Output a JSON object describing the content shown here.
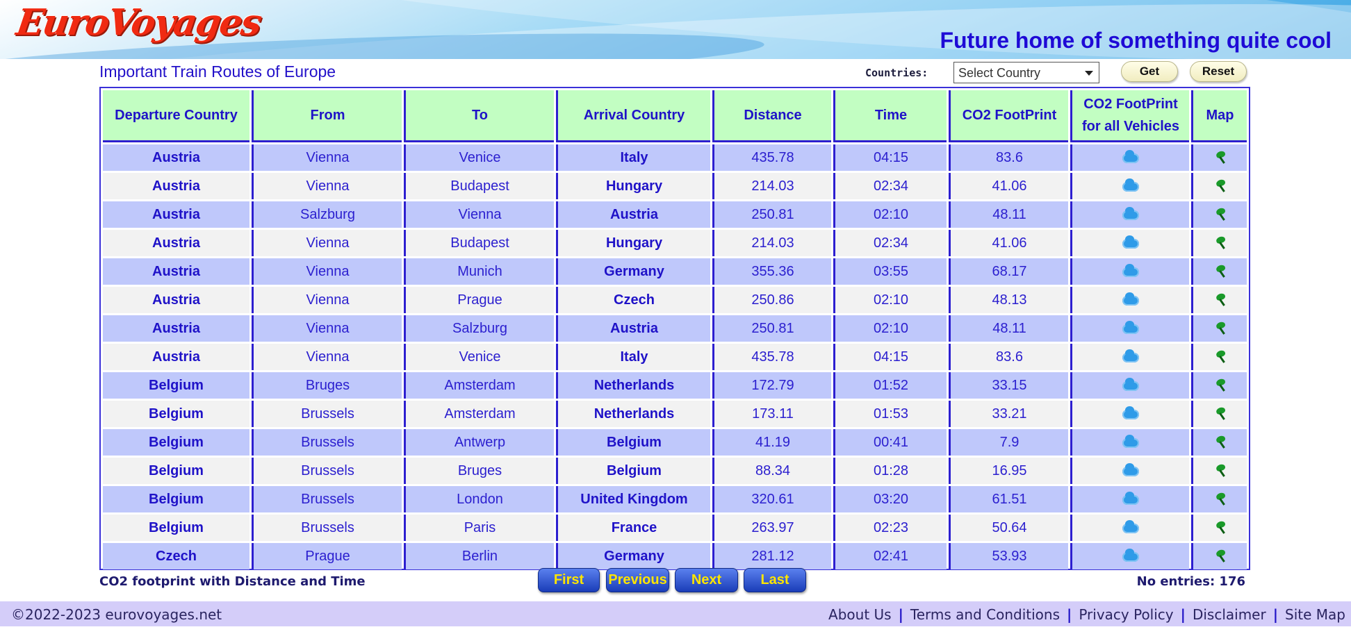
{
  "header": {
    "logo_text": "EuroVoyages",
    "tagline": "Future home of something quite cool"
  },
  "page": {
    "title": "Important Train Routes of Europe",
    "countries_label": "Countries:",
    "country_select_value": "Select Country",
    "get_label": "Get",
    "reset_label": "Reset"
  },
  "table": {
    "columns": [
      "Departure Country",
      "From",
      "To",
      "Arrival Country",
      "Distance",
      "Time",
      "CO2 FootPrint",
      "CO2 FootPrint for all Vehicles",
      "Map"
    ],
    "rows": [
      {
        "dep": "Austria",
        "from": "Vienna",
        "to": "Venice",
        "arr": "Italy",
        "dist": "435.78",
        "time": "04:15",
        "co2": "83.6"
      },
      {
        "dep": "Austria",
        "from": "Vienna",
        "to": "Budapest",
        "arr": "Hungary",
        "dist": "214.03",
        "time": "02:34",
        "co2": "41.06"
      },
      {
        "dep": "Austria",
        "from": "Salzburg",
        "to": "Vienna",
        "arr": "Austria",
        "dist": "250.81",
        "time": "02:10",
        "co2": "48.11"
      },
      {
        "dep": "Austria",
        "from": "Vienna",
        "to": "Budapest",
        "arr": "Hungary",
        "dist": "214.03",
        "time": "02:34",
        "co2": "41.06"
      },
      {
        "dep": "Austria",
        "from": "Vienna",
        "to": "Munich",
        "arr": "Germany",
        "dist": "355.36",
        "time": "03:55",
        "co2": "68.17"
      },
      {
        "dep": "Austria",
        "from": "Vienna",
        "to": "Prague",
        "arr": "Czech",
        "dist": "250.86",
        "time": "02:10",
        "co2": "48.13"
      },
      {
        "dep": "Austria",
        "from": "Vienna",
        "to": "Salzburg",
        "arr": "Austria",
        "dist": "250.81",
        "time": "02:10",
        "co2": "48.11"
      },
      {
        "dep": "Austria",
        "from": "Vienna",
        "to": "Venice",
        "arr": "Italy",
        "dist": "435.78",
        "time": "04:15",
        "co2": "83.6"
      },
      {
        "dep": "Belgium",
        "from": "Bruges",
        "to": "Amsterdam",
        "arr": "Netherlands",
        "dist": "172.79",
        "time": "01:52",
        "co2": "33.15"
      },
      {
        "dep": "Belgium",
        "from": "Brussels",
        "to": "Amsterdam",
        "arr": "Netherlands",
        "dist": "173.11",
        "time": "01:53",
        "co2": "33.21"
      },
      {
        "dep": "Belgium",
        "from": "Brussels",
        "to": "Antwerp",
        "arr": "Belgium",
        "dist": "41.19",
        "time": "00:41",
        "co2": "7.9"
      },
      {
        "dep": "Belgium",
        "from": "Brussels",
        "to": "Bruges",
        "arr": "Belgium",
        "dist": "88.34",
        "time": "01:28",
        "co2": "16.95"
      },
      {
        "dep": "Belgium",
        "from": "Brussels",
        "to": "London",
        "arr": "United Kingdom",
        "dist": "320.61",
        "time": "03:20",
        "co2": "61.51"
      },
      {
        "dep": "Belgium",
        "from": "Brussels",
        "to": "Paris",
        "arr": "France",
        "dist": "263.97",
        "time": "02:23",
        "co2": "50.64"
      },
      {
        "dep": "Czech",
        "from": "Prague",
        "to": "Berlin",
        "arr": "Germany",
        "dist": "281.12",
        "time": "02:41",
        "co2": "53.93"
      }
    ],
    "co2_icon": "co2-cloud-icon",
    "map_icon": "map-pin-icon"
  },
  "bottom": {
    "footnote": "CO2 footprint with Distance and Time",
    "first_label": "First",
    "previous_label": "Previous",
    "next_label": "Next",
    "last_label": "Last",
    "entries_text": "No entries: 176"
  },
  "footer": {
    "copyright": "©2022-2023 eurovoyages.net",
    "links": [
      "About Us",
      "Terms and Conditions",
      "Privacy Policy",
      "Disclaimer",
      "Site Map"
    ]
  },
  "colors": {
    "accent": "#1f12c8",
    "header_row_bg": "#c2fec2",
    "odd_row_bg": "#bfc8fb",
    "even_row_bg": "#f2f2f2",
    "logo": "#f02a12",
    "nav_button_text": "#fde500",
    "footer_bg": "#d4cdf9"
  }
}
